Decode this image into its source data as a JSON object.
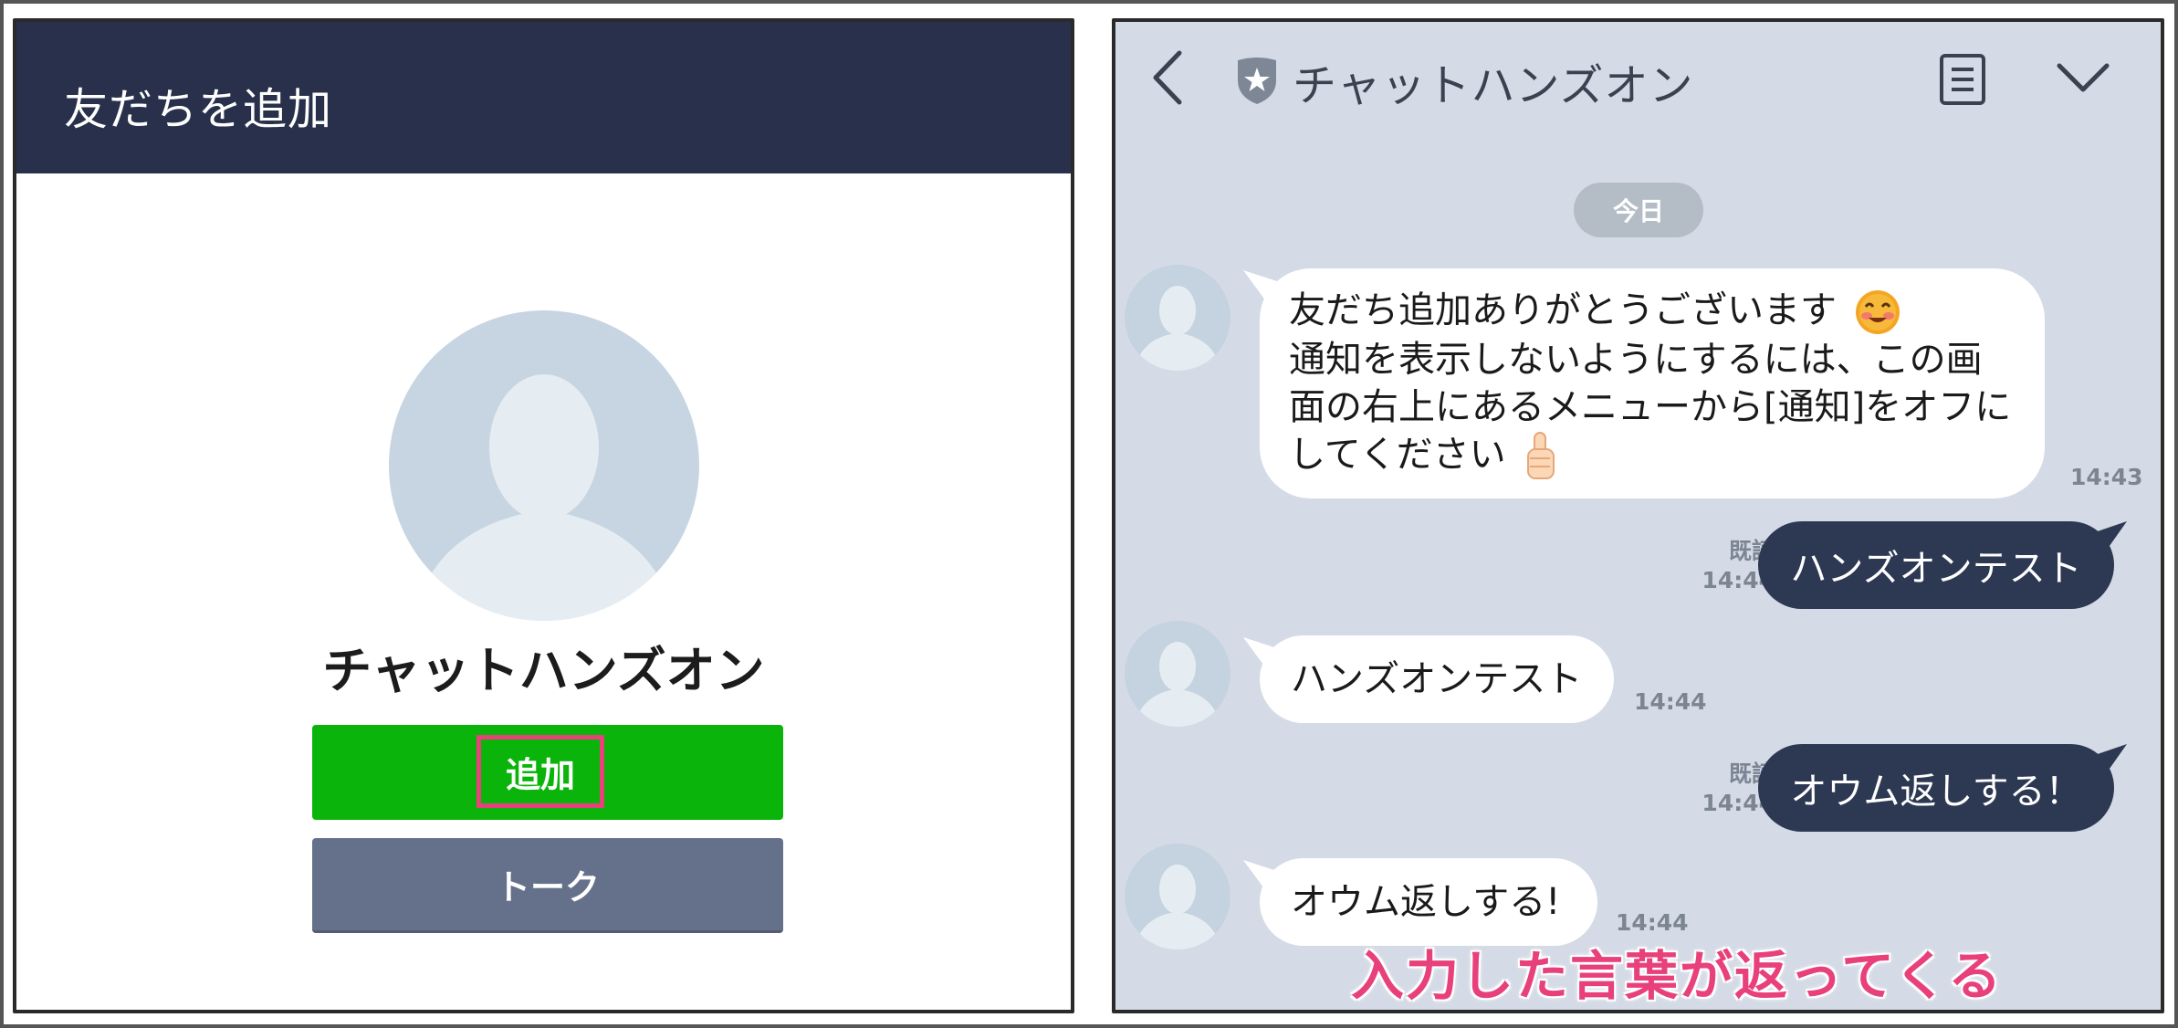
{
  "left": {
    "header_title": "友だちを追加",
    "profile_name": "チャットハンズオン",
    "add_button_label": "追加",
    "talk_button_label": "トーク"
  },
  "right": {
    "header": {
      "title": "チャットハンズオン",
      "icons": [
        "back-icon",
        "shield-star-icon",
        "notes-icon",
        "chevron-down-icon"
      ]
    },
    "date_label": "今日",
    "messages": [
      {
        "direction": "incoming",
        "lines": [
          "友だち追加ありがとうございます",
          "通知を表示しないようにするには、この画",
          "面の右上にあるメニューから[通知]をオフに",
          "してください"
        ],
        "emoji": [
          "smiling-face-emoji",
          "thumbs-up-emoji"
        ],
        "time": "14:43"
      },
      {
        "direction": "outgoing",
        "text": "ハンズオンテスト",
        "read_label": "既読",
        "time": "14:44"
      },
      {
        "direction": "incoming",
        "text": "ハンズオンテスト",
        "time": "14:44"
      },
      {
        "direction": "outgoing",
        "text": "オウム返しする！",
        "read_label": "既読",
        "time": "14:44"
      },
      {
        "direction": "incoming",
        "text": "オウム返しする!",
        "time": "14:44"
      }
    ]
  },
  "annotation": "入力した言葉が返ってくる",
  "colors": {
    "left_header_bg": "#28304b",
    "add_button": "#0ab40a",
    "talk_button": "#65718b",
    "highlight": "#e8407a",
    "chat_bg": "#d5dbe6",
    "outgoing_bubble": "#2d3853",
    "avatar": "#c6d5e1"
  }
}
